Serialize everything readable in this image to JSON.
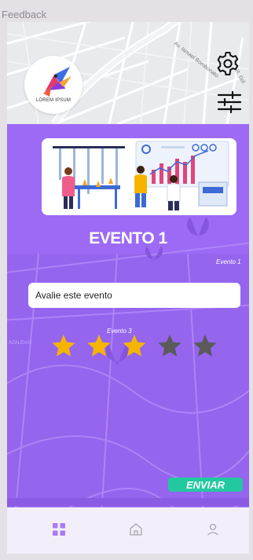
{
  "window": {
    "title": "Feedback"
  },
  "header": {
    "logo_text": "LOREM IPSUM",
    "settings_icon": "gear-icon",
    "filter_icon": "sliders-icon"
  },
  "map": {
    "street_labels": [
      "Av. Ismael Bombonato",
      "R. Bol"
    ],
    "faint_labels": [
      "Evento 1",
      "Evento 3",
      "AZALEIAS"
    ]
  },
  "event": {
    "title": "EVENTO 1"
  },
  "rating": {
    "prompt": "Avalie este evento",
    "value": 3,
    "max": 5,
    "filled_color": "#f5b400",
    "empty_color": "#5a5a5a"
  },
  "actions": {
    "send_label": "ENVIAR"
  },
  "colors": {
    "primary": "#9d6af5",
    "accent": "#22c9a0",
    "nav_bg": "#f3effa"
  },
  "bottom_nav": {
    "items": [
      {
        "icon": "grid-icon",
        "active": true
      },
      {
        "icon": "home-icon",
        "active": false
      },
      {
        "icon": "user-icon",
        "active": false
      }
    ]
  }
}
